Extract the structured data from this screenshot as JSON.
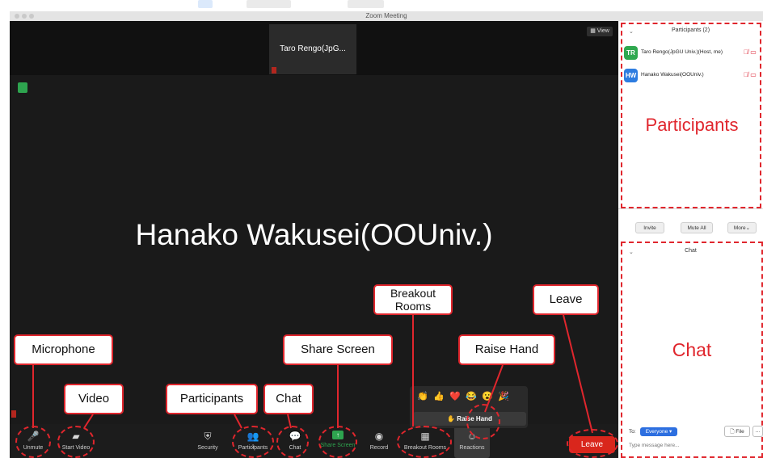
{
  "window": {
    "title": "Zoom Meeting",
    "colors": {
      "leave": "#d9261c",
      "annotation": "#e0262d",
      "share_screen": "#2ea44f",
      "chat_to": "#2d6fe0"
    }
  },
  "video": {
    "view_label": "View",
    "thumbnail_name": "Taro Rengo(JpG...",
    "speaker_name": "Hanako Wakusei(OOUniv.)"
  },
  "toolbar": {
    "unmute": "Unmute",
    "start_video": "Start Video",
    "security": "Security",
    "participants": "Participants",
    "participants_count": "2",
    "chat": "Chat",
    "share_screen": "Share Screen",
    "record": "Record",
    "breakout_rooms": "Breakout Rooms",
    "reactions": "Reactions",
    "leave": "Leave"
  },
  "reactions_popup": {
    "emojis": [
      "👏",
      "👍",
      "❤️",
      "😂",
      "😮",
      "🎉"
    ],
    "raise_hand": "Raise Hand"
  },
  "participants_panel": {
    "title": "Participants (2)",
    "rows": [
      {
        "initials": "TR",
        "name": "Taro Rengo(JpGU Univ.)(Host, me)",
        "color": "#2fa84f"
      },
      {
        "initials": "HW",
        "name": "Hanako Wakusei(OOUniv.)",
        "color": "#2d7ce0"
      }
    ],
    "buttons": {
      "invite": "Invite",
      "mute_all": "Mute All",
      "more": "More"
    }
  },
  "chat_panel": {
    "title": "Chat",
    "to_label": "To:",
    "to_value": "Everyone",
    "file_label": "File",
    "more_label": "...",
    "input_placeholder": "Type message here..."
  },
  "annotations": {
    "microphone": "Microphone",
    "video": "Video",
    "participants": "Participants",
    "chat": "Chat",
    "share_screen": "Share Screen",
    "breakout_rooms_line1": "Breakout",
    "breakout_rooms_line2": "Rooms",
    "raise_hand": "Raise Hand",
    "leave": "Leave",
    "participants_panel": "Participants",
    "chat_panel": "Chat"
  }
}
